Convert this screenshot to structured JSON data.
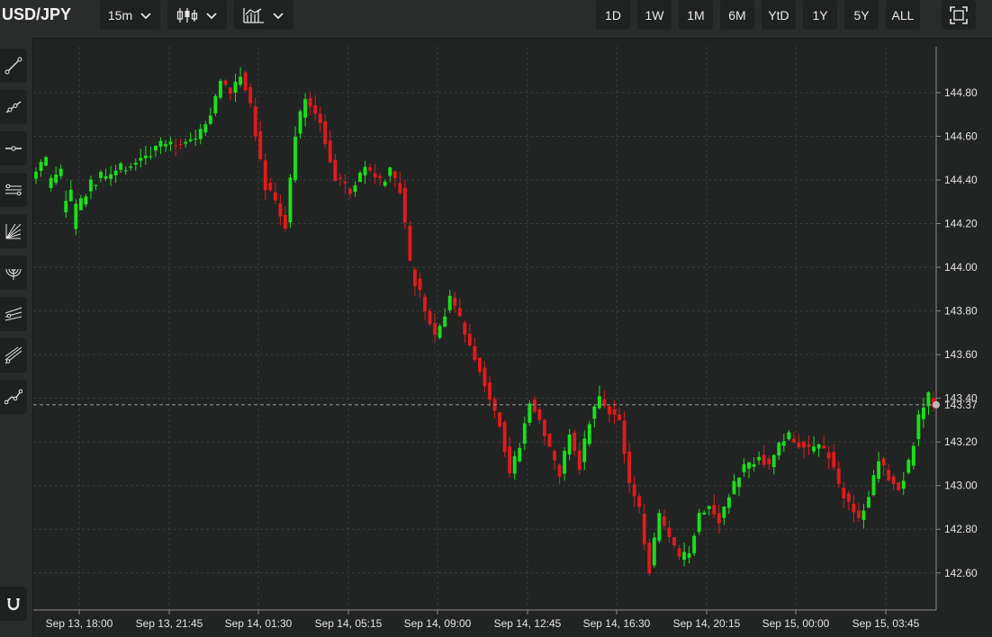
{
  "toolbar": {
    "symbol": "USD/JPY",
    "interval": "15m",
    "chart_type_icon": "candlestick-icon",
    "indicators_icon": "indicators-icon",
    "ranges": [
      "1D",
      "1W",
      "1M",
      "6M",
      "YtD",
      "1Y",
      "5Y",
      "ALL"
    ],
    "fullscreen_icon": "fullscreen-icon"
  },
  "drawing_tools": [
    "trend-line-icon",
    "ray-line-icon",
    "horizontal-line-icon",
    "channel-icon",
    "fan-icon",
    "arc-icon",
    "pitchfork-icon",
    "parallel-lines-icon",
    "path-icon",
    "magnet-icon"
  ],
  "colors": {
    "up": "#19e019",
    "down": "#e01b1b",
    "background": "#222423",
    "grid": "#3a3c3b",
    "current_price_marker": "#b9b9b9"
  },
  "chart_data": {
    "type": "candlestick",
    "title": "USD/JPY",
    "x_tick_labels": [
      "Sep 13, 18:00",
      "Sep 13, 21:45",
      "Sep 14, 01:30",
      "Sep 14, 05:15",
      "Sep 14, 09:00",
      "Sep 14, 12:45",
      "Sep 14, 16:30",
      "Sep 14, 20:15",
      "Sep 15, 00:00",
      "Sep 15, 03:45"
    ],
    "y_tick_labels": [
      "144.80",
      "144.60",
      "144.40",
      "144.20",
      "144.00",
      "143.80",
      "143.60",
      "143.40",
      "143.20",
      "143.00",
      "142.80",
      "142.60"
    ],
    "y_ticks": [
      144.8,
      144.6,
      144.4,
      144.2,
      144.0,
      143.8,
      143.6,
      143.4,
      143.2,
      143.0,
      142.8,
      142.6
    ],
    "ylim": [
      142.43,
      145.01
    ],
    "current_price": 143.37,
    "current_price_label": "143.37",
    "grid": true,
    "candle_anchors": [
      [
        0,
        144.4,
        144.48
      ],
      [
        3,
        144.35,
        144.45
      ],
      [
        6,
        144.25,
        144.35
      ],
      [
        8,
        144.18,
        144.3
      ],
      [
        9,
        144.25,
        144.38
      ],
      [
        12,
        144.38,
        144.42
      ],
      [
        15,
        144.4,
        144.45
      ],
      [
        18,
        144.45,
        144.5
      ],
      [
        22,
        144.5,
        144.55
      ],
      [
        26,
        144.55,
        144.58
      ],
      [
        30,
        144.57,
        144.6
      ],
      [
        33,
        144.58,
        144.7
      ],
      [
        36,
        144.7,
        144.85
      ],
      [
        38,
        144.85,
        144.8
      ],
      [
        40,
        144.8,
        144.9
      ],
      [
        42,
        144.9,
        144.75
      ],
      [
        44,
        144.75,
        144.38
      ],
      [
        47,
        144.38,
        144.3
      ],
      [
        49,
        144.3,
        144.2
      ],
      [
        51,
        144.2,
        144.6
      ],
      [
        53,
        144.6,
        144.78
      ],
      [
        55,
        144.78,
        144.68
      ],
      [
        58,
        144.68,
        144.4
      ],
      [
        61,
        144.4,
        144.35
      ],
      [
        64,
        144.35,
        144.45
      ],
      [
        67,
        144.45,
        144.38
      ],
      [
        70,
        144.38,
        144.43
      ],
      [
        72,
        144.43,
        144.35
      ],
      [
        74,
        144.35,
        144.0
      ],
      [
        76,
        144.0,
        143.8
      ],
      [
        79,
        143.8,
        143.68
      ],
      [
        81,
        143.68,
        143.85
      ],
      [
        84,
        143.85,
        143.7
      ],
      [
        87,
        143.7,
        143.55
      ],
      [
        90,
        143.55,
        143.4
      ],
      [
        92,
        143.4,
        143.3
      ],
      [
        94,
        143.3,
        143.05
      ],
      [
        96,
        143.05,
        143.2
      ],
      [
        98,
        143.2,
        143.4
      ],
      [
        100,
        143.4,
        143.3
      ],
      [
        102,
        143.3,
        143.15
      ],
      [
        104,
        143.15,
        143.05
      ],
      [
        106,
        143.05,
        143.25
      ],
      [
        108,
        143.25,
        143.1
      ],
      [
        110,
        143.1,
        143.3
      ],
      [
        112,
        143.3,
        143.4
      ],
      [
        114,
        143.4,
        143.35
      ],
      [
        116,
        143.35,
        143.3
      ],
      [
        118,
        143.3,
        143.0
      ],
      [
        120,
        143.0,
        142.88
      ],
      [
        122,
        142.88,
        142.62
      ],
      [
        124,
        142.62,
        142.85
      ],
      [
        126,
        142.85,
        142.75
      ],
      [
        128,
        142.75,
        142.65
      ],
      [
        130,
        142.65,
        142.7
      ],
      [
        132,
        142.7,
        142.88
      ],
      [
        134,
        142.88,
        142.92
      ],
      [
        136,
        142.92,
        142.85
      ],
      [
        138,
        142.85,
        142.95
      ],
      [
        140,
        142.95,
        143.05
      ],
      [
        142,
        143.05,
        143.1
      ],
      [
        144,
        143.1,
        143.15
      ],
      [
        146,
        143.15,
        143.08
      ],
      [
        148,
        143.08,
        143.18
      ],
      [
        150,
        143.18,
        143.22
      ],
      [
        152,
        143.22,
        143.2
      ],
      [
        154,
        143.2,
        143.15
      ],
      [
        156,
        143.15,
        143.18
      ],
      [
        158,
        143.18,
        143.15
      ],
      [
        160,
        143.15,
        143.0
      ],
      [
        162,
        143.0,
        142.92
      ],
      [
        164,
        142.92,
        142.85
      ],
      [
        166,
        142.85,
        142.95
      ],
      [
        168,
        142.95,
        143.12
      ],
      [
        170,
        143.12,
        143.05
      ],
      [
        172,
        143.05,
        143.0
      ],
      [
        174,
        143.0,
        143.1
      ],
      [
        176,
        143.1,
        143.3
      ],
      [
        178,
        143.3,
        143.4
      ],
      [
        180,
        143.4,
        143.36
      ]
    ]
  }
}
